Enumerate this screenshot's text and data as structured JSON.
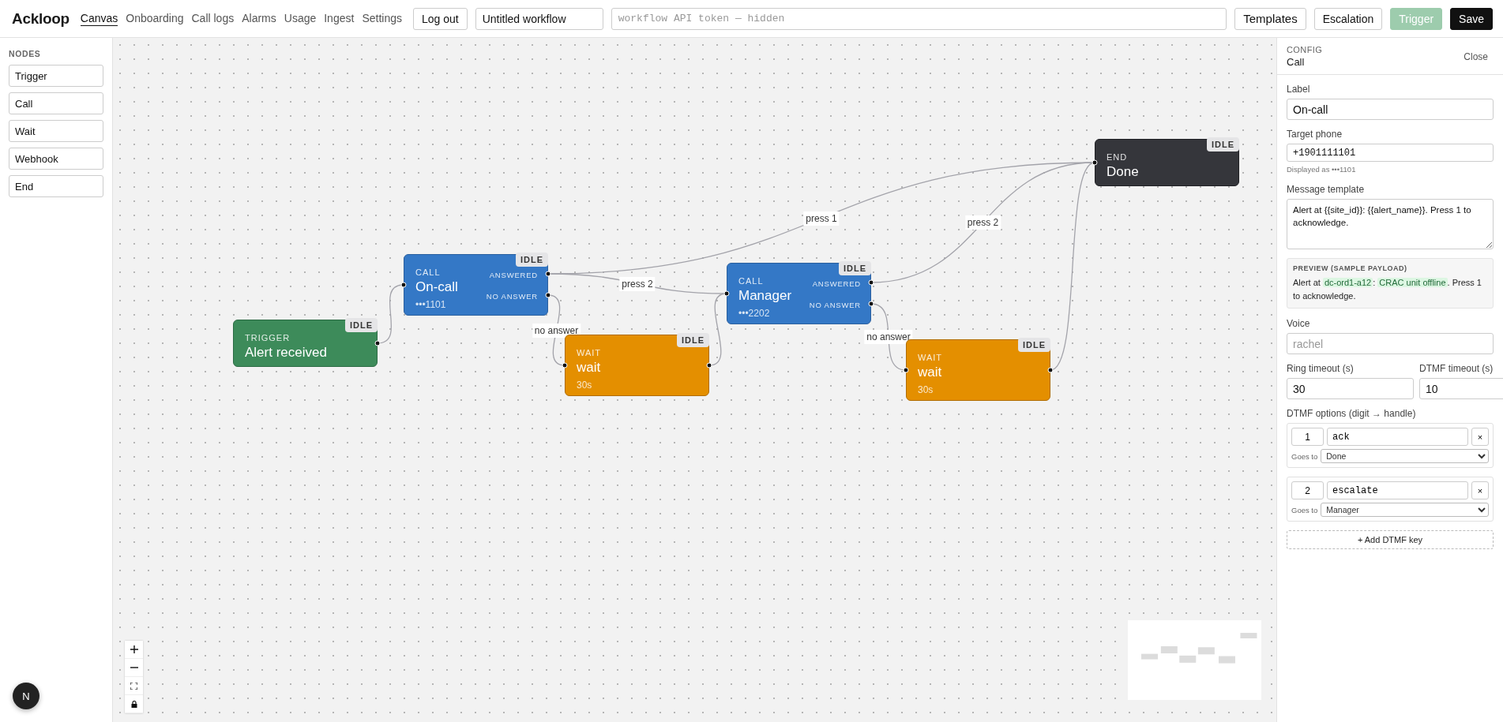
{
  "logo": "Ackloop",
  "nav": [
    {
      "label": "Canvas",
      "selected": true
    },
    {
      "label": "Onboarding",
      "selected": false
    },
    {
      "label": "Call logs",
      "selected": false
    },
    {
      "label": "Alarms",
      "selected": false
    },
    {
      "label": "Usage",
      "selected": false
    },
    {
      "label": "Ingest",
      "selected": false
    },
    {
      "label": "Settings",
      "selected": false
    }
  ],
  "logout": "Log out",
  "workflow_name": {
    "value": "Untitled workflow"
  },
  "api_token": {
    "placeholder": "workflow API token — hidden"
  },
  "actions": [
    {
      "label": "Templates",
      "kind": "outline",
      "disabled": false
    },
    {
      "label": "Escalation",
      "kind": "outline",
      "disabled": false
    },
    {
      "label": "Trigger",
      "kind": "success",
      "disabled": true
    },
    {
      "label": "Save",
      "kind": "dark",
      "disabled": false
    }
  ],
  "palette": {
    "title": "NODES",
    "items": [
      "Trigger",
      "Call",
      "Wait",
      "Webhook",
      "End"
    ]
  },
  "dev_badge": "N",
  "canvas": {
    "nodes": [
      {
        "kind": "trigger",
        "type_label": "TRIGGER",
        "title": "Alert received",
        "status": "IDLE"
      },
      {
        "kind": "call",
        "type_label": "CALL",
        "title": "On-call",
        "subtitle": "•••1101",
        "ports": [
          "ANSWERED",
          "NO ANSWER"
        ],
        "status": "IDLE"
      },
      {
        "kind": "wait",
        "type_label": "WAIT",
        "title": "wait",
        "subtitle": "30s",
        "status": "IDLE"
      },
      {
        "kind": "call",
        "type_label": "CALL",
        "title": "Manager",
        "subtitle": "•••2202",
        "ports": [
          "ANSWERED",
          "NO ANSWER"
        ],
        "status": "IDLE"
      },
      {
        "kind": "wait",
        "type_label": "WAIT",
        "title": "wait",
        "subtitle": "30s",
        "status": "IDLE"
      },
      {
        "kind": "end",
        "type_label": "END",
        "title": "Done",
        "status": "IDLE"
      }
    ],
    "edge_labels": [
      "press 1",
      "press 2",
      "no answer",
      "press 2",
      "no answer"
    ]
  },
  "config": {
    "header": "CONFIG",
    "title": "Call",
    "close": "Close",
    "label": {
      "label": "Label",
      "value": "On-call"
    },
    "target_phone": {
      "label": "Target phone",
      "value": "+1901111101",
      "hint": "Displayed as •••1101"
    },
    "message_template": {
      "label": "Message template",
      "value": "Alert at {{site_id}}: {{alert_name}}. Press 1 to acknowledge."
    },
    "preview": {
      "title": "PREVIEW (SAMPLE PAYLOAD)",
      "parts": [
        {
          "text": "Alert at ",
          "highlight": false
        },
        {
          "text": "dc-ord1-a12",
          "highlight": true
        },
        {
          "text": ": ",
          "highlight": false
        },
        {
          "text": "CRAC unit offline",
          "highlight": true
        },
        {
          "text": ". Press 1 to acknowledge.",
          "highlight": false
        }
      ]
    },
    "voice": {
      "label": "Voice",
      "placeholder": "rachel"
    },
    "ring_timeout": {
      "label": "Ring timeout (s)",
      "value": "30"
    },
    "dtmf_timeout": {
      "label": "DTMF timeout (s)",
      "value": "10"
    },
    "dtmf": {
      "label": "DTMF options (digit → handle)",
      "options": [
        {
          "digit": "1",
          "handle": "ack",
          "remove": "×",
          "goes_to_label": "Goes to",
          "goes_to": "Done"
        },
        {
          "digit": "2",
          "handle": "escalate",
          "remove": "×",
          "goes_to_label": "Goes to",
          "goes_to": "Manager"
        }
      ],
      "add": "+ Add DTMF key"
    }
  }
}
